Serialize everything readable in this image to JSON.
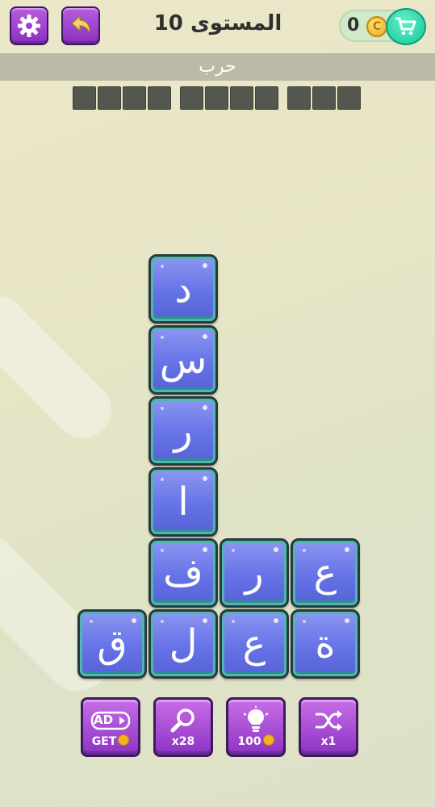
{
  "header": {
    "level_title": "المستوى 10",
    "coins": "0",
    "coin_symbol": "C"
  },
  "clue": "حرب",
  "answer_slots": {
    "groups": [
      4,
      4,
      3
    ]
  },
  "grid": {
    "tiles": [
      {
        "letter": "د",
        "col": 2,
        "row": 0
      },
      {
        "letter": "س",
        "col": 2,
        "row": 1
      },
      {
        "letter": "ر",
        "col": 2,
        "row": 2
      },
      {
        "letter": "ا",
        "col": 2,
        "row": 3
      },
      {
        "letter": "ف",
        "col": 2,
        "row": 4
      },
      {
        "letter": "ر",
        "col": 3,
        "row": 4
      },
      {
        "letter": "ع",
        "col": 4,
        "row": 4
      },
      {
        "letter": "ق",
        "col": 1,
        "row": 5
      },
      {
        "letter": "ل",
        "col": 2,
        "row": 5
      },
      {
        "letter": "ع",
        "col": 3,
        "row": 5
      },
      {
        "letter": "ة",
        "col": 4,
        "row": 5
      }
    ]
  },
  "toolbar": {
    "ad_label": "AD",
    "get_label": "GET",
    "search_count": "x28",
    "hint_cost": "100",
    "shuffle_count": "x1"
  },
  "colors": {
    "tile": "#6673e6",
    "button": "#a44ad6",
    "coin": "#f2b21e",
    "cart": "#17c79a"
  }
}
